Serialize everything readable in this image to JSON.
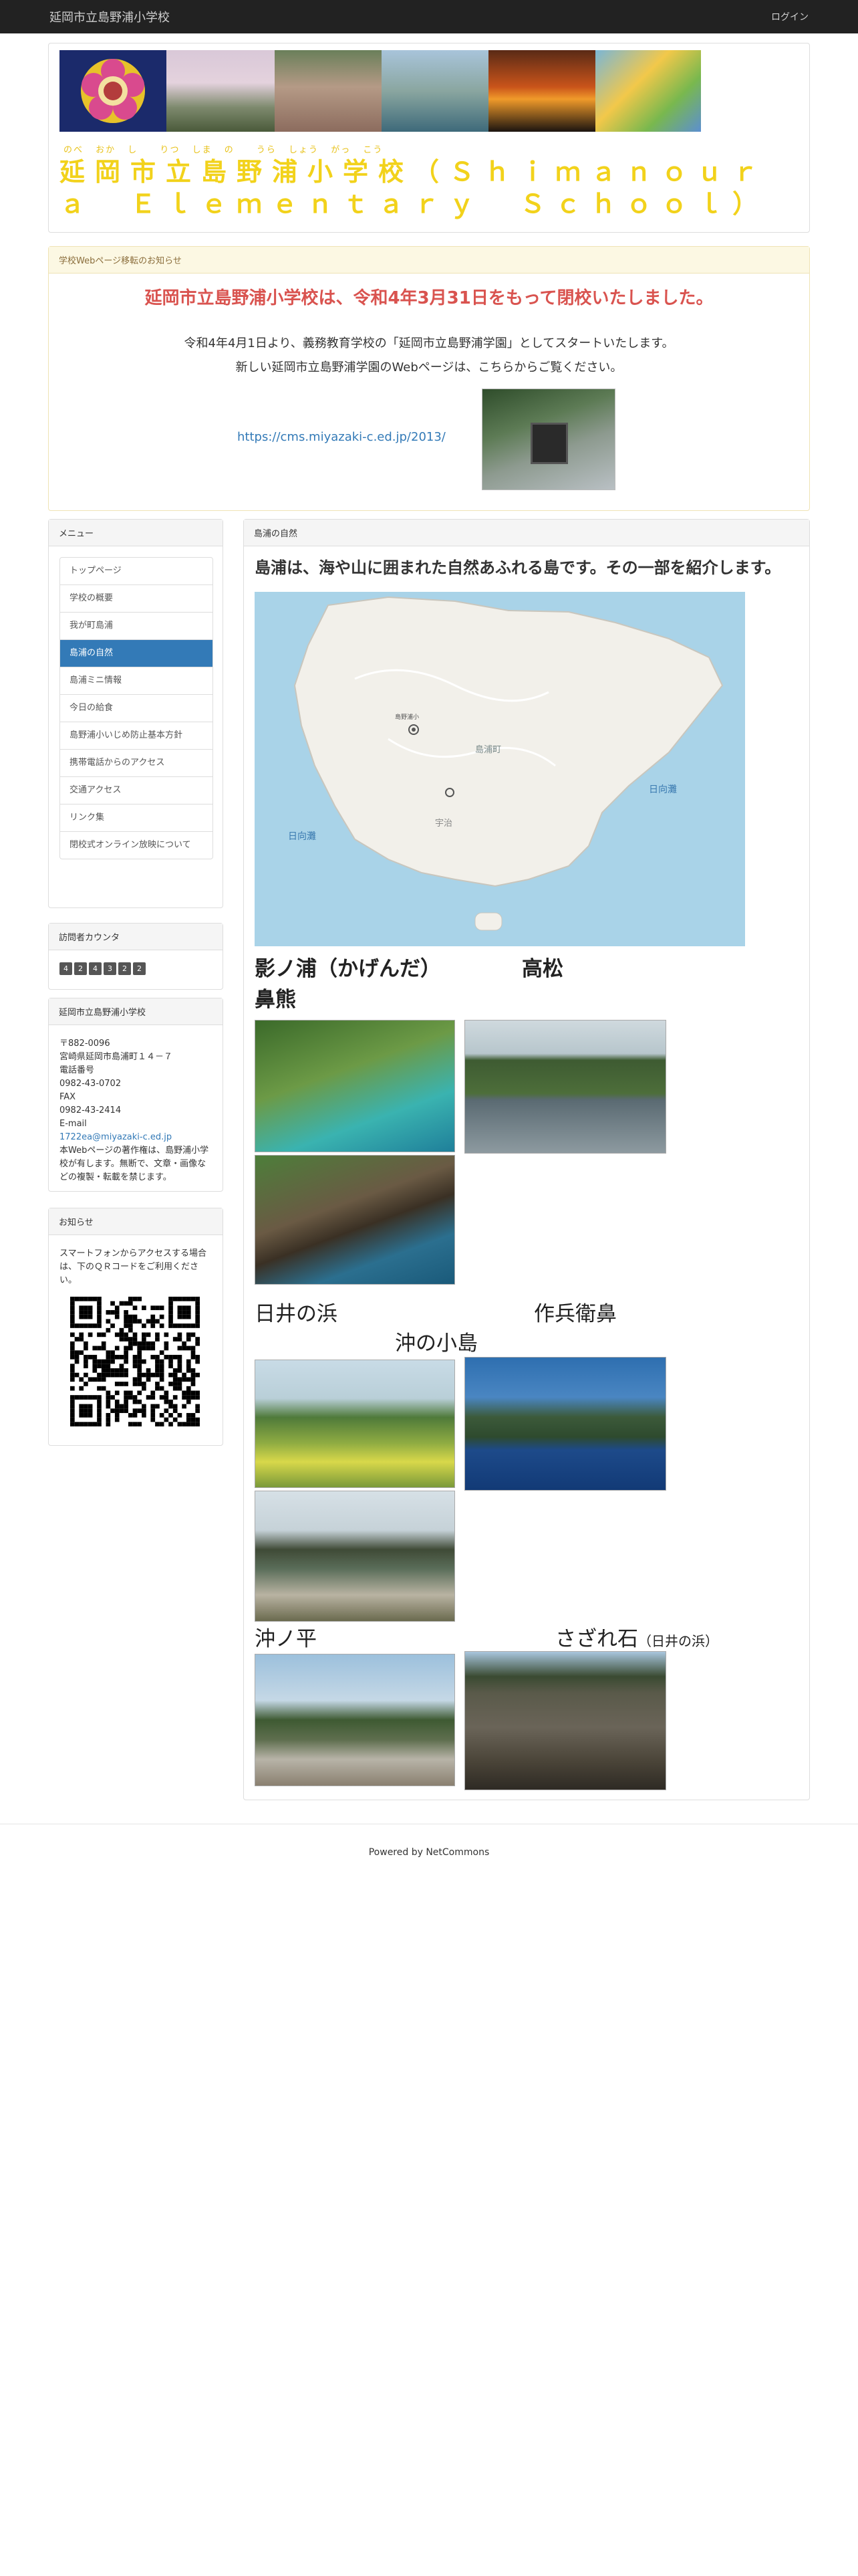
{
  "navbar": {
    "brand": "延岡市立島野浦小学校",
    "login": "ログイン"
  },
  "header": {
    "ruby": "のべ おか し　 りつ しま の　 うら しょう がっ こう",
    "title": "延岡市立島野浦小学校（Ｓｈｉｍａｎｏｕｒａ　Ｅｌｅｍｅｎｔａｒｙ　Ｓｃｈｏｏｌ）"
  },
  "notice": {
    "heading": "学校Webページ移転のお知らせ",
    "headline": "延岡市立島野浦小学校は、令和4年3月31日をもって閉校いたしました。",
    "line1": "令和4年4月1日より、義務教育学校の「延岡市立島野浦学園」としてスタートいたします。",
    "line2": "新しい延岡市立島野浦学園のWebページは、こちらからご覧ください。",
    "link": "https://cms.miyazaki-c.ed.jp/2013/"
  },
  "menu": {
    "heading": "メニュー",
    "items": [
      {
        "label": "トップページ"
      },
      {
        "label": "学校の概要"
      },
      {
        "label": "我が町島浦"
      },
      {
        "label": "島浦の自然"
      },
      {
        "label": "島浦ミニ情報"
      },
      {
        "label": "今日の給食"
      },
      {
        "label": "島野浦小いじめ防止基本方針"
      },
      {
        "label": "携帯電話からのアクセス"
      },
      {
        "label": "交通アクセス"
      },
      {
        "label": "リンク集"
      },
      {
        "label": "閉校式オンライン放映について"
      }
    ],
    "active_index": 3
  },
  "counter": {
    "heading": "訪問者カウンタ",
    "digits": [
      "4",
      "2",
      "4",
      "3",
      "2",
      "2"
    ]
  },
  "school": {
    "heading": "延岡市立島野浦小学校",
    "postal": "〒882-0096",
    "address": "宮崎県延岡市島浦町１４－７",
    "tel_label": "電話番号",
    "tel": "0982-43-0702",
    "fax_label": "FAX",
    "fax": "0982-43-2414",
    "email_label": "E-mail",
    "email": "1722ea@miyazaki-c.ed.jp",
    "copyright": "本Webページの著作権は、島野浦小学校が有します。無断で、文章・画像などの複製・転載を禁じます。"
  },
  "notice_panel": {
    "heading": "お知らせ",
    "text": "スマートフォンからアクセスする場合は、下のＱＲコードをご利用ください。"
  },
  "main": {
    "heading": "島浦の自然",
    "lead": "島浦は、海や山に囲まれた自然あふれる島です。その一部を紹介します。",
    "captions": {
      "c1": "影ノ浦（かげんだ）",
      "c2": "高松",
      "c3": "鼻熊",
      "c4": "日井の浜",
      "c5": "作兵衛鼻",
      "c6": "沖の小島",
      "c7": "沖ノ平",
      "c8": "さざれ石",
      "c8_small": "（日井の浜）"
    },
    "map_labels": [
      "島浦町",
      "日向灘",
      "日向灘",
      "宇治",
      "島野浦小"
    ]
  },
  "footer": {
    "text": "Powered by NetCommons"
  },
  "colors": {
    "accent": "#337ab7",
    "title_yellow": "#f2d21b",
    "alert_red": "#d9534f",
    "navbar": "#222222"
  }
}
